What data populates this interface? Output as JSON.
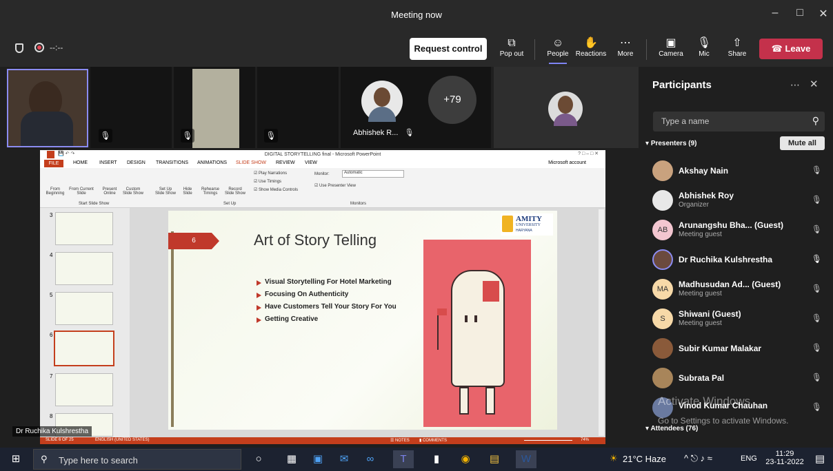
{
  "window": {
    "title": "Meeting now"
  },
  "toolbar": {
    "timer": "--:--",
    "request_control": "Request control",
    "pop_out": "Pop out",
    "people": "People",
    "reactions": "Reactions",
    "more": "More",
    "camera": "Camera",
    "mic": "Mic",
    "share": "Share",
    "leave": "Leave"
  },
  "stage": {
    "overflow_count": "+79",
    "tile_abhishek": "Abhishek R...",
    "speaker_name": "Dr Ruchika Kulshrestha"
  },
  "ppt": {
    "window_title": "DIGITAL STORYTELLING final - Microsoft PowerPoint",
    "account": "Microsoft account",
    "tabs": [
      "FILE",
      "HOME",
      "INSERT",
      "DESIGN",
      "TRANSITIONS",
      "ANIMATIONS",
      "SLIDE SHOW",
      "REVIEW",
      "VIEW"
    ],
    "ribbon": {
      "from_beginning": "From Beginning",
      "from_current": "From Current Slide",
      "present_online": "Present Online",
      "custom_show": "Custom Slide Show",
      "setup_show": "Set Up Slide Show",
      "hide_slide": "Hide Slide",
      "rehearse": "Rehearse Timings",
      "record": "Record Slide Show",
      "play_narrations": "Play Narrations",
      "use_timings": "Use Timings",
      "show_media": "Show Media Controls",
      "monitor_label": "Monitor:",
      "monitor_value": "Automatic",
      "presenter_view": "Use Presenter View",
      "group_start": "Start Slide Show",
      "group_setup": "Set Up",
      "group_monitors": "Monitors"
    },
    "thumb_numbers": [
      "3",
      "4",
      "5",
      "6",
      "7",
      "8"
    ],
    "slide": {
      "number": "6",
      "title": "Art of Story Telling",
      "bullets": [
        "Visual Storytelling For Hotel Marketing",
        "Focusing On Authenticity",
        "Have Customers Tell Your Story For You",
        "Getting Creative"
      ],
      "logo_line1": "AMITY",
      "logo_line2": "UNIVERSITY",
      "logo_line3": "HARYANA"
    },
    "status": {
      "slide_of": "SLIDE 6 OF 25",
      "language": "ENGLISH (UNITED STATES)",
      "notes": "NOTES",
      "comments": "COMMENTS",
      "zoom": "74%"
    }
  },
  "sidebar": {
    "title": "Participants",
    "search_placeholder": "Type a name",
    "presenters_label": "Presenters (9)",
    "mute_all": "Mute all",
    "attendees_label": "Attendees (76)",
    "participants": [
      {
        "name": "Akshay Nain",
        "sub": ""
      },
      {
        "name": "Abhishek Roy",
        "sub": "Organizer"
      },
      {
        "name": "Arunangshu Bha... (Guest)",
        "sub": "Meeting guest",
        "initials": "AB"
      },
      {
        "name": "Dr Ruchika Kulshrestha",
        "sub": ""
      },
      {
        "name": "Madhusudan Ad... (Guest)",
        "sub": "Meeting guest",
        "initials": "MA"
      },
      {
        "name": "Shiwani (Guest)",
        "sub": "Meeting guest",
        "initials": "S"
      },
      {
        "name": "Subir Kumar Malakar",
        "sub": ""
      },
      {
        "name": "Subrata Pal",
        "sub": ""
      },
      {
        "name": "Vinod Kumar Chauhan",
        "sub": ""
      }
    ],
    "watermark_line1": "Activate Windows",
    "watermark_line2": "Go to Settings to activate Windows."
  },
  "taskbar": {
    "search_placeholder": "Type here to search",
    "weather": "21°C Haze",
    "lang": "ENG",
    "time": "11:29",
    "date": "23-11-2022"
  },
  "colors": {
    "teams_bg": "#292929",
    "leave_red": "#c4314b",
    "ppt_orange": "#c43e1c",
    "slide_red": "#c0392b"
  }
}
